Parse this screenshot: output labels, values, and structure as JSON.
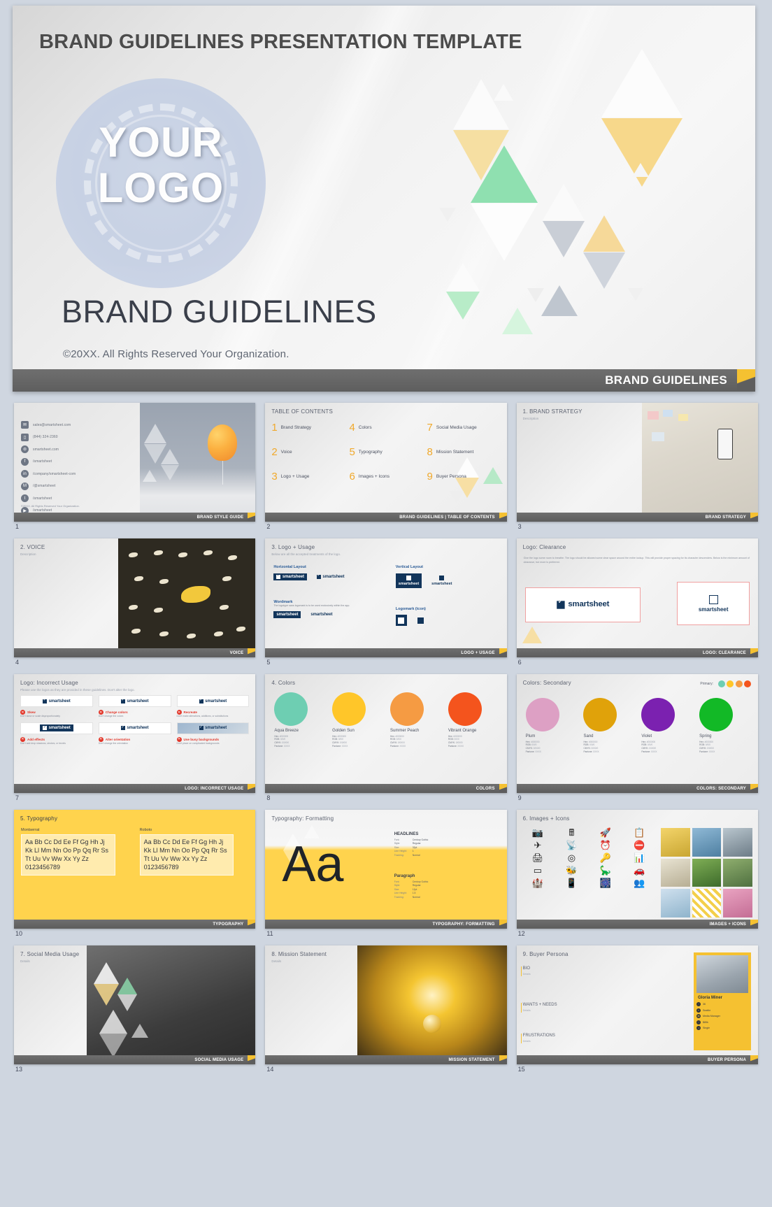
{
  "hero": {
    "header": "BRAND GUIDELINES PRESENTATION TEMPLATE",
    "logo_line1": "YOUR",
    "logo_line2": "LOGO",
    "heading": "BRAND GUIDELINES",
    "copyright": "©20XX. All Rights Reserved Your Organization.",
    "footer_label": "BRAND GUIDELINES"
  },
  "colors": {
    "accent_yellow": "#F5C131",
    "footer_gray": "#5E5E5E",
    "toc_number": "#F0A92C",
    "page_bg": "#CFD6E0"
  },
  "slides": [
    {
      "num": "1",
      "footer": "BRAND STYLE GUIDE",
      "contacts": [
        {
          "icon": "envelope-icon",
          "glyph": "✉",
          "text": "sales@smartsheet.com"
        },
        {
          "icon": "phone-icon",
          "glyph": "▯",
          "text": "(844) 324-2360"
        },
        {
          "icon": "globe-icon",
          "glyph": "⊜",
          "text": "smartsheet.com"
        },
        {
          "icon": "facebook-icon",
          "glyph": "f",
          "text": "/smartsheet"
        },
        {
          "icon": "linkedin-icon",
          "glyph": "in",
          "text": "/company/smartsheet-com"
        },
        {
          "icon": "medium-icon",
          "glyph": "M",
          "text": "/@smartsheet"
        },
        {
          "icon": "twitter-icon",
          "glyph": "t",
          "text": "/smartsheet"
        },
        {
          "icon": "youtube-icon",
          "glyph": "▶",
          "text": "/smartsheet"
        }
      ],
      "copyright": "©20XX. All Rights Reserved Your Organization."
    },
    {
      "num": "2",
      "title": "TABLE OF CONTENTS",
      "footer": "BRAND GUIDELINES  |  TABLE OF CONTENTS",
      "toc": [
        {
          "n": "1",
          "label": "Brand Strategy"
        },
        {
          "n": "4",
          "label": "Colors"
        },
        {
          "n": "7",
          "label": "Social Media Usage"
        },
        {
          "n": "2",
          "label": "Voice"
        },
        {
          "n": "5",
          "label": "Typography"
        },
        {
          "n": "8",
          "label": "Mission Statement"
        },
        {
          "n": "3",
          "label": "Logo + Usage"
        },
        {
          "n": "6",
          "label": "Images + Icons"
        },
        {
          "n": "9",
          "label": "Buyer Persona"
        }
      ]
    },
    {
      "num": "3",
      "title": "1. BRAND STRATEGY",
      "subtitle": "Description",
      "footer": "BRAND STRATEGY"
    },
    {
      "num": "4",
      "title": "2. VOICE",
      "subtitle": "Description",
      "footer": "VOICE"
    },
    {
      "num": "5",
      "title": "3. Logo + Usage",
      "subtitle": "Below are all the accepted treatments of the logo.",
      "footer": "LOGO + USAGE",
      "blocks": [
        {
          "heading": "Horizontal Layout",
          "desc": ""
        },
        {
          "heading": "Vertical Layout",
          "desc": ""
        },
        {
          "heading": "Wordmark",
          "desc": "The logotype sans logomark is to be used exclusively within the app."
        },
        {
          "heading": "Logomark (icon)",
          "desc": ""
        }
      ],
      "wordmark": "smartsheet"
    },
    {
      "num": "6",
      "title": "Logo: Clearance",
      "footer": "LOGO: CLEARANCE",
      "body": "Give the logo some room to breathe. The logo should be allowed some clear space around the entire lockup. This will provide proper spacing for its character descenders. Below is the minimum amount of clearance, but more is preferred.",
      "wordmark": "smartsheet"
    },
    {
      "num": "7",
      "title": "Logo: Incorrect Usage",
      "subtitle": "Please use the logos as they are provided in these guidelines. Don't alter the logo.",
      "footer": "LOGO: INCORRECT USAGE",
      "rules": [
        {
          "title": "Skew",
          "desc": "Don't skew or scale disproportionately"
        },
        {
          "title": "Change colors",
          "desc": "Don't change the colors"
        },
        {
          "title": "Recreate",
          "desc": "Don't make alterations, additions, or substitutions"
        },
        {
          "title": "Add effects",
          "desc": "Don't add drop shadows, strokes, or bevels"
        },
        {
          "title": "Alter orientation",
          "desc": "Don't change the orientation"
        },
        {
          "title": "Use busy backgrounds",
          "desc": "Don't place on complicated backgrounds"
        }
      ]
    },
    {
      "num": "8",
      "title": "4. Colors",
      "footer": "COLORS",
      "swatches": [
        {
          "name": "Aqua Breeze",
          "color": "#6ECEB2",
          "hex": "#000000",
          "rgb": "0/0/0",
          "cmyk": "0/0/0/0",
          "pantone": "XXXX"
        },
        {
          "name": "Golden Sun",
          "color": "#FFC629",
          "hex": "#000000",
          "rgb": "0/0/0",
          "cmyk": "0/0/0/0",
          "pantone": "XXXX"
        },
        {
          "name": "Summer Peach",
          "color": "#F59B43",
          "hex": "#000000",
          "rgb": "0/0/0",
          "cmyk": "0/0/0/0",
          "pantone": "XXXX"
        },
        {
          "name": "Vibrant Orange",
          "color": "#F4541D",
          "hex": "#000000",
          "rgb": "0/0/0",
          "cmyk": "0/0/0/0",
          "pantone": "XXXX"
        }
      ],
      "labels": {
        "hex": "Hex:",
        "rgb": "RGB:",
        "cmyk": "CMYK:",
        "pantone": "Pantone:"
      }
    },
    {
      "num": "9",
      "title": "Colors: Secondary",
      "footer": "COLORS: SECONDARY",
      "primary_label": "Primary:",
      "primary_dots": [
        "#6ECEB2",
        "#FFC629",
        "#F59B43",
        "#F4541D"
      ],
      "swatches": [
        {
          "name": "Plum",
          "color": "#DDA0C4",
          "hex": "#000000",
          "rgb": "0/0/0",
          "cmyk": "0/0/0/0",
          "pantone": "XXXX"
        },
        {
          "name": "Sand",
          "color": "#E0A20A",
          "hex": "#000000",
          "rgb": "0/0/0",
          "cmyk": "0/0/0/0",
          "pantone": "XXXX"
        },
        {
          "name": "Violet",
          "color": "#7B21B0",
          "hex": "#000000",
          "rgb": "0/0/0",
          "cmyk": "0/0/0/0",
          "pantone": "XXXX"
        },
        {
          "name": "Spring",
          "color": "#12B926",
          "hex": "#000000",
          "rgb": "0/0/0",
          "cmyk": "0/0/0/0",
          "pantone": "XXXX"
        }
      ],
      "labels": {
        "hex": "Hex:",
        "rgb": "RGB:",
        "cmyk": "CMYK:",
        "pantone": "Pantone:"
      }
    },
    {
      "num": "10",
      "title": "5. Typography",
      "footer": "TYPOGRAPHY",
      "fonts": [
        {
          "name": "Montserrat",
          "sample": "Aa Bb Cc Dd Ee Ff Gg Hh Jj Kk Ll Mm Nn Oo Pp Qq Rr Ss Tt Uu Vv Ww Xx Yy Zz 0123456789"
        },
        {
          "name": "Roboto",
          "sample": "Aa Bb Cc Dd Ee Ff Gg Hh Jj Kk Ll Mm Nn Oo Pp Qq Rr Ss Tt Uu Vv Ww Xx Yy Zz 0123456789"
        }
      ]
    },
    {
      "num": "11",
      "title": "Typography:  Formatting",
      "footer": "TYPOGRAPHY:  FORMATTING",
      "sample": "Aa",
      "specs": [
        {
          "heading": "HEADLINES",
          "rows": [
            {
              "k": "Font:",
              "v": "Century Gothic"
            },
            {
              "k": "Style:",
              "v": "Regular"
            },
            {
              "k": "Size:",
              "v": "32pt"
            },
            {
              "k": "Line Height:",
              "v": "1"
            },
            {
              "k": "Tracking:",
              "v": "Normal"
            }
          ]
        },
        {
          "heading": "Paragraph",
          "rows": [
            {
              "k": "Font:",
              "v": "Century Gothic"
            },
            {
              "k": "Style:",
              "v": "Regular"
            },
            {
              "k": "Size:",
              "v": "12pt"
            },
            {
              "k": "Line Height:",
              "v": "1.5"
            },
            {
              "k": "Tracking:",
              "v": "Normal"
            }
          ]
        }
      ]
    },
    {
      "num": "12",
      "title": "6. Images + Icons",
      "footer": "IMAGES + ICONS",
      "icons": [
        "camera-icon",
        "calculator-icon",
        "rocket-icon",
        "clipboard-icon",
        "airplane-icon",
        "satellite-icon",
        "alarm-clock-icon",
        "no-entry-icon",
        "printer-icon",
        "target-icon",
        "key-icon",
        "bar-chart-icon",
        "battery-icon",
        "bee-icon",
        "dinosaur-icon",
        "car-wash-icon",
        "castle-icon",
        "mobile-location-icon",
        "fence-icon",
        "audience-icon"
      ],
      "icon_glyphs": [
        "📷",
        "🖩",
        "🚀",
        "📋",
        "✈",
        "📡",
        "⏰",
        "⛔",
        "🖨",
        "◎",
        "🔑",
        "📊",
        "▭",
        "🐝",
        "🦕",
        "🚗",
        "🏰",
        "📱",
        "🎆",
        "👥"
      ]
    },
    {
      "num": "13",
      "title": "7. Social Media Usage",
      "subtitle": "Details",
      "footer": "SOCIAL MEDIA USAGE"
    },
    {
      "num": "14",
      "title": "8. Mission Statement",
      "subtitle": "Details",
      "footer": "MISSION STATEMENT"
    },
    {
      "num": "15",
      "title": "9. Buyer Persona",
      "footer": "BUYER PERSONA",
      "sections": [
        {
          "heading": "BIO",
          "sub": "Details"
        },
        {
          "heading": "WANTS + NEEDS",
          "sub": "Details"
        },
        {
          "heading": "FRUSTRATIONS",
          "sub": "Details"
        }
      ],
      "persona": {
        "name": "Gloria Miner",
        "facts": [
          {
            "icon": "age-icon",
            "glyph": "◔",
            "text": "36"
          },
          {
            "icon": "location-icon",
            "glyph": "⌖",
            "text": "Seattle"
          },
          {
            "icon": "job-icon",
            "glyph": "▤",
            "text": "Media Manager"
          },
          {
            "icon": "family-icon",
            "glyph": "♡",
            "text": "$85k"
          },
          {
            "icon": "status-icon",
            "glyph": "◑",
            "text": "Single"
          }
        ]
      }
    }
  ]
}
